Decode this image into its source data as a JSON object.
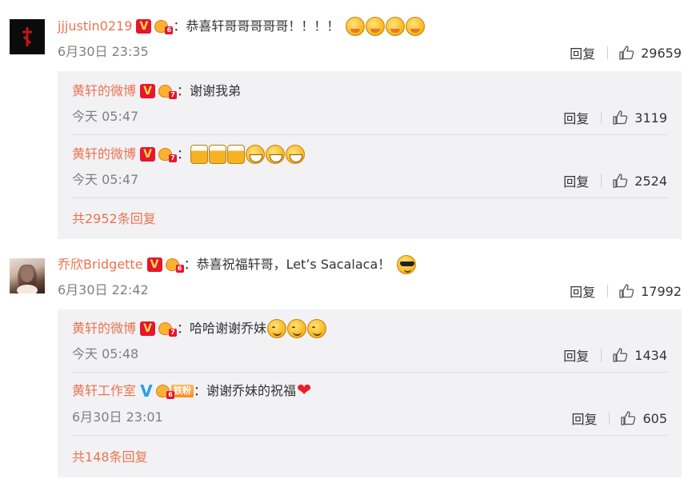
{
  "comments": [
    {
      "username": "jjjustin0219",
      "verify_badge": "V",
      "level": "6",
      "text": "恭喜轩哥哥哥哥哥！！！！",
      "emojis": [
        "shy-emoji",
        "shy-emoji",
        "shy-emoji",
        "shy-emoji"
      ],
      "time": "6月30日 23:35",
      "reply_label": "回复",
      "likes": "29659",
      "replies": [
        {
          "username": "黄轩的微博",
          "verify_badge": "V",
          "level": "7",
          "text": "谢谢我弟",
          "time": "今天 05:47",
          "reply_label": "回复",
          "likes": "3119"
        },
        {
          "username": "黄轩的微博",
          "verify_badge": "V",
          "level": "7",
          "text": "",
          "emojis": [
            "beer-emoji",
            "beer-emoji",
            "beer-emoji",
            "grin-emoji",
            "grin-emoji",
            "grin-emoji"
          ],
          "time": "今天 05:47",
          "reply_label": "回复",
          "likes": "2524"
        }
      ],
      "more_replies": "共2952条回复"
    },
    {
      "username": "乔欣Bridgette",
      "verify_badge": "V",
      "level": "6",
      "text": "恭喜祝福轩哥，Let’s Sacalaca！",
      "emojis": [
        "cool-emoji"
      ],
      "time": "6月30日 22:42",
      "reply_label": "回复",
      "likes": "17992",
      "replies": [
        {
          "username": "黄轩的微博",
          "verify_badge": "V",
          "level": "7",
          "text": "哈哈谢谢乔妹",
          "emojis": [
            "smile-emoji",
            "smile-emoji",
            "smile-emoji"
          ],
          "time": "今天 05:48",
          "reply_label": "回复",
          "likes": "1434"
        },
        {
          "username": "黄轩工作室",
          "verify_badge": "V",
          "level": "6",
          "fan_badge": "铁粉",
          "text": "谢谢乔妹的祝福",
          "emojis": [
            "heart-emoji"
          ],
          "time": "6月30日 23:01",
          "reply_label": "回复",
          "likes": "605"
        }
      ],
      "more_replies": "共148条回复"
    }
  ],
  "colon": "：",
  "colors": {
    "username": "#eb7350",
    "reply_bg": "#f2f2f5",
    "meta": "#808080"
  }
}
